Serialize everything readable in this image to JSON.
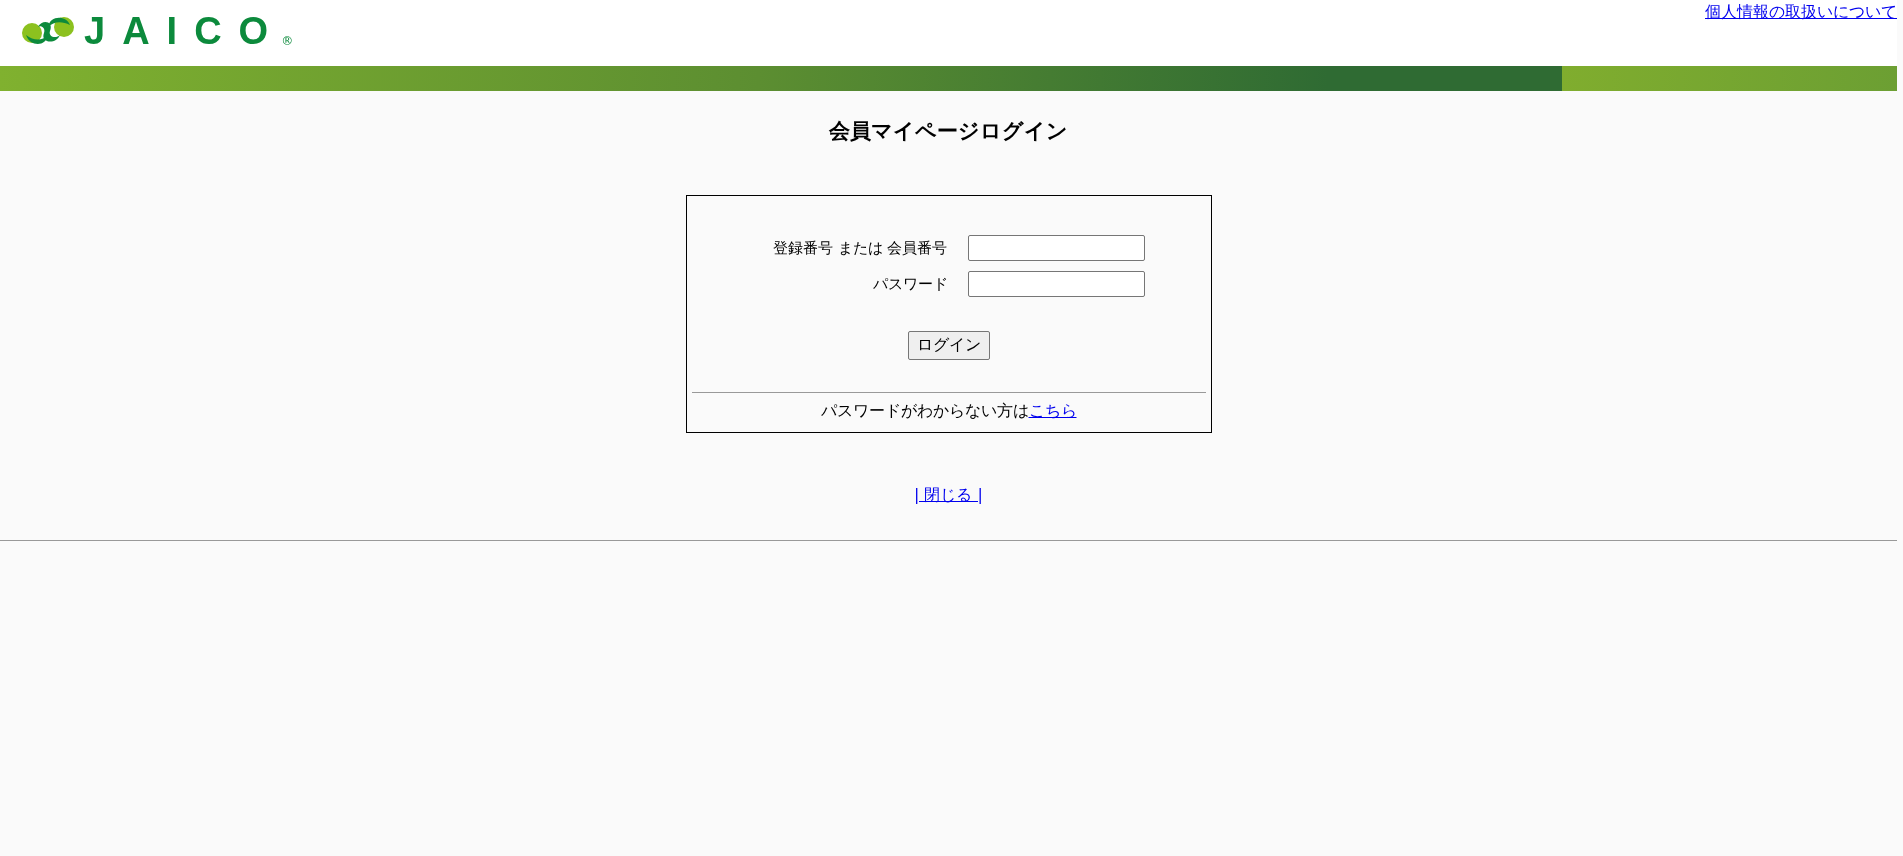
{
  "header": {
    "logo_text": "JAICO",
    "logo_mark": "®",
    "privacy_link": "個人情報の取扱いについて"
  },
  "title": "会員マイページログイン",
  "form": {
    "fields": [
      {
        "label": "登録番号 または 会員番号"
      },
      {
        "label": "パスワード"
      }
    ],
    "submit": "ログイン",
    "help_text": "パスワードがわからない方は",
    "help_link": "こちら"
  },
  "close_link": "| 閉じる |"
}
